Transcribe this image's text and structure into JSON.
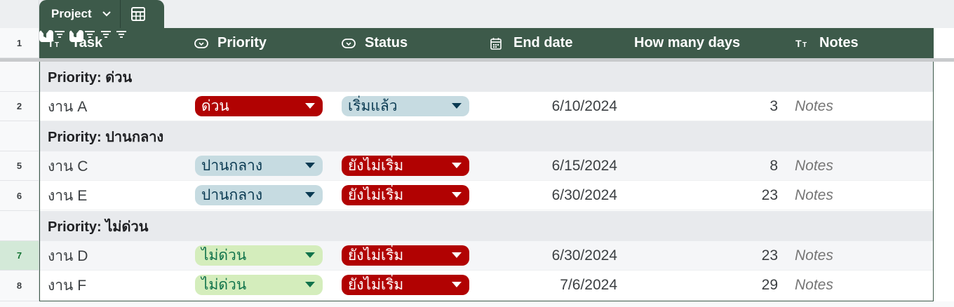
{
  "table": {
    "name": "Project",
    "columns": [
      {
        "label": "Task",
        "type_icon": "text-type-icon",
        "filter_icon": "filter-active-icon"
      },
      {
        "label": "Priority",
        "type_icon": "dropdown-type-icon",
        "filter_icon": "filter-icon"
      },
      {
        "label": "Status",
        "type_icon": "dropdown-type-icon",
        "filter_icon": "filter-active-icon"
      },
      {
        "label": "End date",
        "type_icon": "calendar-type-icon",
        "filter_icon": "filter-icon"
      },
      {
        "label": "How many days",
        "type_icon": "",
        "filter_icon": "filter-icon"
      },
      {
        "label": "Notes",
        "type_icon": "text-type-icon",
        "filter_icon": "filter-icon"
      }
    ]
  },
  "row_numbers": [
    "1",
    "2",
    "5",
    "6",
    "7",
    "8"
  ],
  "groups": [
    {
      "label": "Priority: ด่วน"
    },
    {
      "label": "Priority: ปานกลาง"
    },
    {
      "label": "Priority: ไม่ด่วน"
    }
  ],
  "rows": [
    {
      "task": "งาน A",
      "priority": "ด่วน",
      "status": "เริ่มแล้ว",
      "end_date": "6/10/2024",
      "days": "3",
      "notes": "Notes"
    },
    {
      "task": "งาน C",
      "priority": "ปานกลาง",
      "status": "ยังไม่เริ่ม",
      "end_date": "6/15/2024",
      "days": "8",
      "notes": "Notes"
    },
    {
      "task": "งาน E",
      "priority": "ปานกลาง",
      "status": "ยังไม่เริ่ม",
      "end_date": "6/30/2024",
      "days": "23",
      "notes": "Notes"
    },
    {
      "task": "งาน D",
      "priority": "ไม่ด่วน",
      "status": "ยังไม่เริ่ม",
      "end_date": "6/30/2024",
      "days": "23",
      "notes": "Notes"
    },
    {
      "task": "งาน F",
      "priority": "ไม่ด่วน",
      "status": "ยังไม่เริ่ม",
      "end_date": "7/6/2024",
      "days": "29",
      "notes": "Notes"
    }
  ],
  "colors": {
    "header_bg": "#3d5a4a",
    "chip_red": "#b10202",
    "chip_blue": "#c6dbe1",
    "chip_green": "#d4edbc",
    "group_bg": "#e8eaed"
  }
}
